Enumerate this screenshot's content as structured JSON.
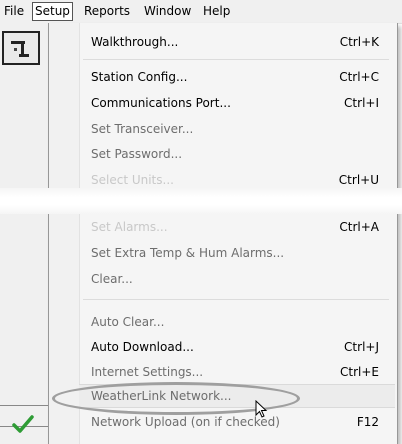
{
  "menubar": {
    "items": [
      {
        "label": "File"
      },
      {
        "label": "Setup"
      },
      {
        "label": "Reports"
      },
      {
        "label": "Window"
      },
      {
        "label": "Help"
      }
    ]
  },
  "menu": {
    "items": [
      {
        "label": "Walkthrough...",
        "shortcut": "Ctrl+K",
        "state": "enabled"
      },
      {
        "label": "Station Config...",
        "shortcut": "Ctrl+C",
        "state": "enabled"
      },
      {
        "label": "Communications Port...",
        "shortcut": "Ctrl+I",
        "state": "enabled"
      },
      {
        "label": "Set Transceiver...",
        "shortcut": "",
        "state": "disabled"
      },
      {
        "label": "Set Password...",
        "shortcut": "",
        "state": "disabled"
      },
      {
        "label": "Select Units...",
        "shortcut": "Ctrl+U",
        "state": "faded"
      },
      {
        "label": "Set Alarms...",
        "shortcut": "Ctrl+A",
        "state": "faded"
      },
      {
        "label": "Set Extra Temp & Hum Alarms...",
        "shortcut": "",
        "state": "disabled"
      },
      {
        "label": "Clear...",
        "shortcut": "",
        "state": "disabled"
      },
      {
        "label": "Auto Clear...",
        "shortcut": "",
        "state": "disabled"
      },
      {
        "label": "Auto Download...",
        "shortcut": "Ctrl+J",
        "state": "enabled"
      },
      {
        "label": "Internet Settings...",
        "shortcut": "Ctrl+E",
        "state": "disabled"
      },
      {
        "label": "WeatherLink Network...",
        "shortcut": "",
        "state": "disabled"
      },
      {
        "label": "Network Upload (on if checked)",
        "shortcut": "F12",
        "state": "disabled",
        "checked": true
      }
    ]
  },
  "colors": {
    "checkmark": "#2e9c35",
    "menu_bg": "#f5f5f5"
  },
  "icons": {
    "toolbar": "download-station-icon",
    "check": "checkmark-icon",
    "cursor": "mouse-cursor-icon"
  }
}
